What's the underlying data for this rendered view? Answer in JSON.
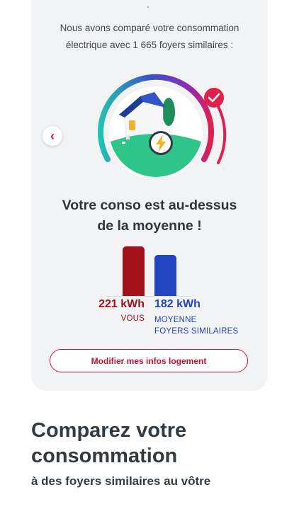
{
  "intro": {
    "line1": "Nous avons comparé votre consommation",
    "line2": "électrique avec 1 665 foyers similaires :"
  },
  "icons": {
    "prev": "chevron-left-icon",
    "check": "check-badge-icon",
    "lightning": "lightning-icon",
    "house": "house-illustration"
  },
  "headline": {
    "line1": "Votre conso est au-dessus",
    "line2": "de la moyenne !"
  },
  "comparison": {
    "you": {
      "value": 221,
      "value_text": "221 kWh",
      "label": "VOUS",
      "color": "#a3111d"
    },
    "average": {
      "value": 182,
      "value_text": "182 kWh",
      "label_line1": "MOYENNE",
      "label_line2": "FOYERS SIMILAIRES",
      "color": "#2244c0"
    }
  },
  "modify_button": {
    "label": "Modifier mes infos logement"
  },
  "promo": {
    "title_line1": "Comparez votre",
    "title_line2": "consommation",
    "subtitle": "à des foyers similaires au vôtre"
  },
  "colors": {
    "accent": "#d0142c",
    "card_bg": "#f2f3f4",
    "green": "#2ec48a",
    "house_roof": "#2f55c9"
  }
}
